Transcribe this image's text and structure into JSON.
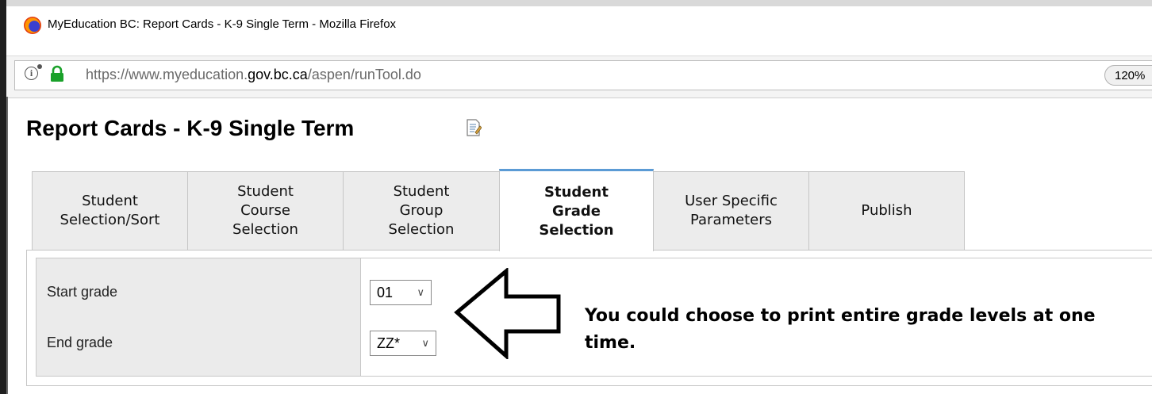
{
  "window": {
    "title": "MyEducation BC: Report Cards - K-9 Single Term - Mozilla Firefox"
  },
  "browser": {
    "url_prefix": "https://www.myeducation.",
    "url_domain": "gov.bc.ca",
    "url_path": "/aspen/runTool.do",
    "zoom": "120%"
  },
  "page": {
    "title": "Report Cards - K-9 Single Term"
  },
  "tabs": [
    {
      "lines": [
        "Student",
        "Selection/Sort"
      ],
      "active": false
    },
    {
      "lines": [
        "Student",
        "Course",
        "Selection"
      ],
      "active": false
    },
    {
      "lines": [
        "Student",
        "Group",
        "Selection"
      ],
      "active": false
    },
    {
      "lines": [
        "Student",
        "Grade",
        "Selection"
      ],
      "active": true
    },
    {
      "lines": [
        "User Specific",
        "Parameters"
      ],
      "active": false
    },
    {
      "lines": [
        "Publish"
      ],
      "active": false
    }
  ],
  "form": {
    "start_grade_label": "Start grade",
    "start_grade_value": "01",
    "end_grade_label": "End grade",
    "end_grade_value": "ZZ*"
  },
  "annotation": {
    "text": "You could choose to print entire grade levels at one time."
  },
  "colors": {
    "active_tab_accent": "#5b9bd5",
    "tab_bg": "#ececec",
    "label_col_bg": "#ebebeb",
    "lock_green": "#1aa12a"
  },
  "icons": [
    "firefox-logo-icon",
    "info-icon",
    "lock-icon",
    "report-doc-icon",
    "chevron-down-icon",
    "arrow-left-icon"
  ]
}
